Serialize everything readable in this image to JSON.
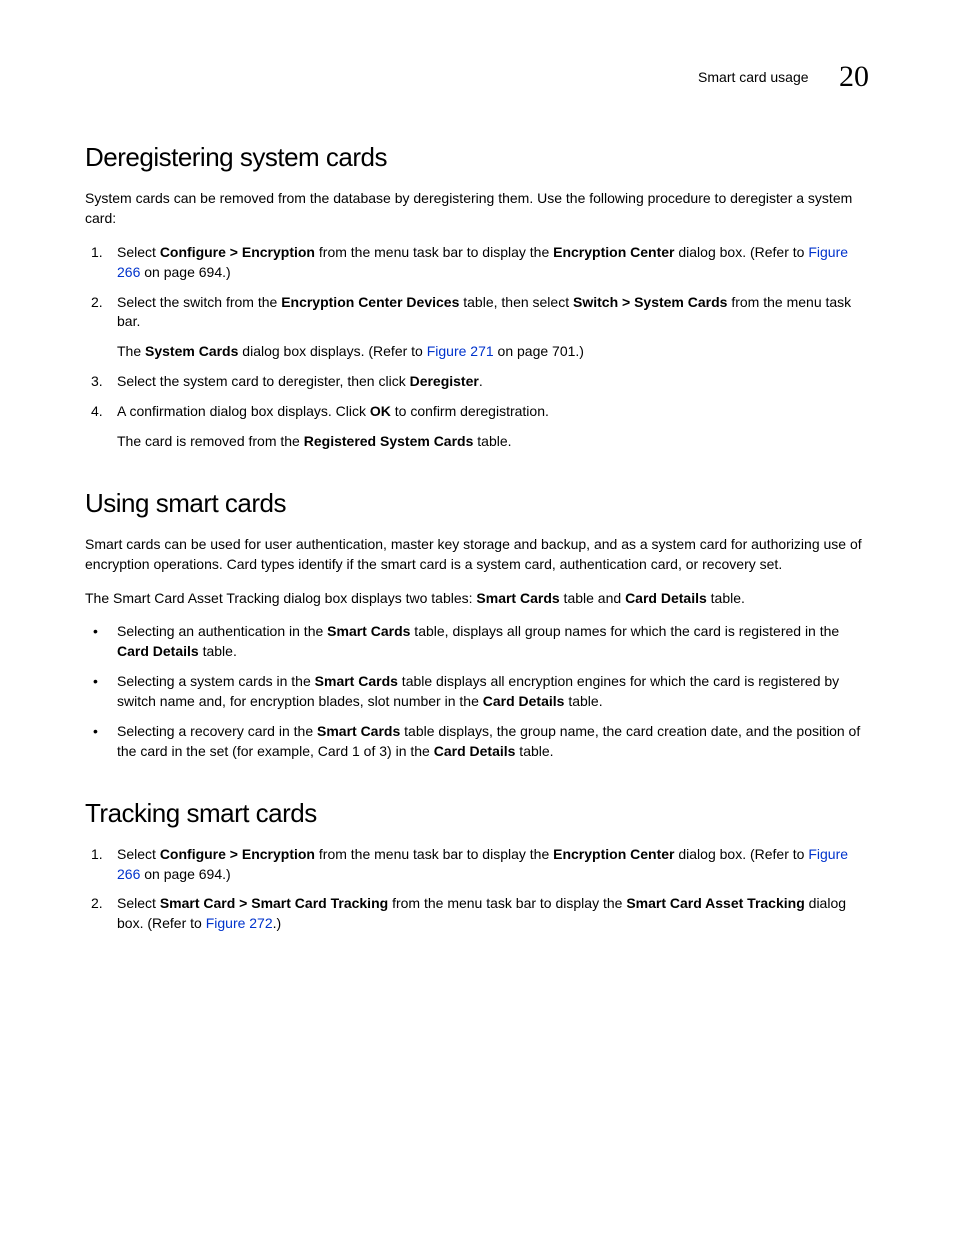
{
  "header": {
    "label": "Smart card usage",
    "chapter": "20"
  },
  "section1": {
    "heading": "Deregistering system cards",
    "intro": "System cards can be removed from the database by deregistering them. Use the following procedure to deregister a system card:",
    "step1_a": "Select ",
    "step1_b": "Configure > Encryption",
    "step1_c": " from the menu task bar to display the ",
    "step1_d": "Encryption Center",
    "step1_e": " dialog box. (Refer to ",
    "step1_link": "Figure 266",
    "step1_f": " on page 694.)",
    "step2_a": "Select the switch from the ",
    "step2_b": "Encryption Center Devices",
    "step2_c": " table, then select ",
    "step2_d": "Switch > System Cards",
    "step2_e": " from the menu task bar.",
    "step2_sub_a": "The ",
    "step2_sub_b": "System Cards",
    "step2_sub_c": " dialog box displays. (Refer to ",
    "step2_sub_link": "Figure 271",
    "step2_sub_d": " on page 701.)",
    "step3_a": "Select the system card to deregister, then click ",
    "step3_b": "Deregister",
    "step3_c": ".",
    "step4_a": "A confirmation dialog box displays. Click ",
    "step4_b": "OK",
    "step4_c": " to confirm deregistration.",
    "step4_sub_a": "The card is removed from the ",
    "step4_sub_b": "Registered System Cards",
    "step4_sub_c": " table."
  },
  "section2": {
    "heading": "Using smart cards",
    "p1": "Smart cards can be used for user authentication, master key storage and backup, and as a system card for authorizing use of encryption operations. Card types identify if the smart card is a system card, authentication card, or recovery set.",
    "p2_a": "The Smart Card Asset Tracking dialog box displays two tables: ",
    "p2_b": "Smart Cards",
    "p2_c": " table and ",
    "p2_d": "Card Details",
    "p2_e": " table.",
    "b1_a": "Selecting an authentication in the ",
    "b1_b": "Smart Cards",
    "b1_c": " table, displays all group names for which the card is registered in the ",
    "b1_d": "Card Details",
    "b1_e": " table.",
    "b2_a": "Selecting a system cards in the ",
    "b2_b": "Smart Cards",
    "b2_c": " table displays all encryption engines for which the card is registered by switch name and, for encryption blades, slot number in the ",
    "b2_d": "Card Details",
    "b2_e": " table.",
    "b3_a": "Selecting a recovery card in the ",
    "b3_b": "Smart Cards",
    "b3_c": " table displays, the group name, the card creation date, and the position of the card in the set (for example, Card 1 of 3) in the ",
    "b3_d": "Card Details",
    "b3_e": " table."
  },
  "section3": {
    "heading": "Tracking smart cards",
    "step1_a": "Select ",
    "step1_b": "Configure > Encryption",
    "step1_c": " from the menu task bar to display the ",
    "step1_d": "Encryption Center",
    "step1_e": " dialog box. (Refer to ",
    "step1_link": "Figure 266",
    "step1_f": " on page 694.)",
    "step2_a": "Select ",
    "step2_b": "Smart Card > Smart Card Tracking",
    "step2_c": " from the menu task bar to display the ",
    "step2_d": "Smart Card Asset Tracking",
    "step2_e": " dialog box. (Refer to ",
    "step2_link": "Figure 272",
    "step2_f": ".)"
  }
}
